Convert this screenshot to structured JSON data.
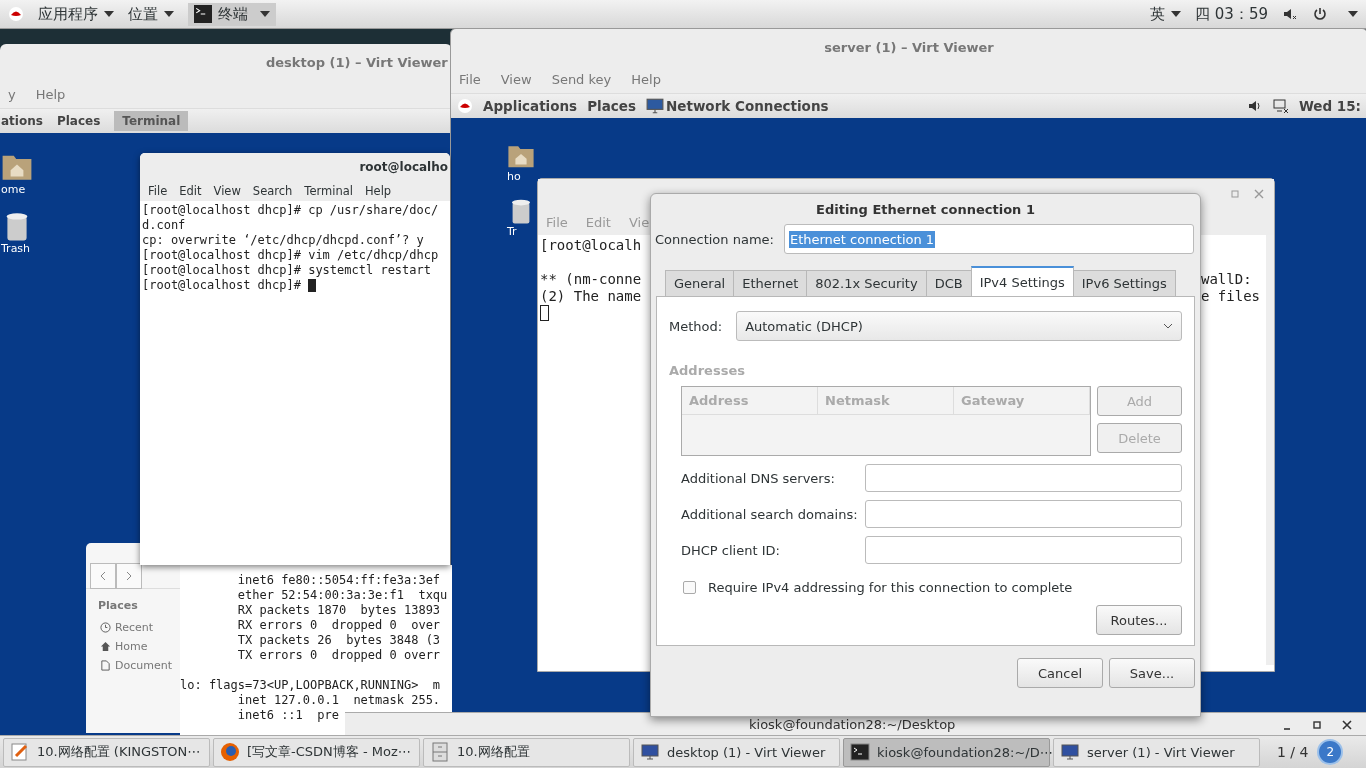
{
  "top_bar": {
    "apps_menu": "应用程序",
    "places_menu": "位置",
    "task": "终端",
    "input_method": "英",
    "clock": "四 03：59"
  },
  "desktop_viewer": {
    "title": "desktop (1) – Virt Viewer",
    "menu": [
      "y",
      "Help"
    ],
    "guest_panel": {
      "menus": [
        "ations",
        "Places"
      ],
      "task": "Terminal"
    },
    "icons": [
      {
        "kind": "folder",
        "label": "ome"
      },
      {
        "kind": "trash",
        "label": "Trash"
      }
    ],
    "terminal": {
      "title": "root@localho",
      "menu": [
        "File",
        "Edit",
        "View",
        "Search",
        "Terminal",
        "Help"
      ],
      "lines": [
        "[root@localhost dhcp]# cp /usr/share/doc/",
        "d.conf",
        "cp: overwrite ‘/etc/dhcp/dhcpd.conf’? y",
        "[root@localhost dhcp]# vim /etc/dhcp/dhcp",
        "[root@localhost dhcp]# systemctl restart"
      ],
      "prompt": "[root@localhost dhcp]#"
    },
    "files": {
      "heading": "Places",
      "items": [
        {
          "kind": "recent",
          "label": "Recent"
        },
        {
          "kind": "home",
          "label": "Home"
        },
        {
          "kind": "document",
          "label": "Document"
        }
      ]
    },
    "output": {
      "blocks": [
        [
          "        inet6 fe80::5054:ff:fe3a:3ef",
          "        ether 52:54:00:3a:3e:f1  txqu",
          "        RX packets 1870  bytes 13893",
          "        RX errors 0  dropped 0  over",
          "        TX packets 26  bytes 3848 (3",
          "        TX errors 0  dropped 0 overr"
        ],
        [
          "lo: flags=73<UP,LOOPBACK,RUNNING>  m",
          "        inet 127.0.0.1  netmask 255.",
          "        inet6 ::1  pre"
        ]
      ]
    }
  },
  "server_viewer": {
    "title": "server (1) – Virt Viewer",
    "menu": [
      "File",
      "View",
      "Send key",
      "Help"
    ],
    "guest_panel": {
      "menus": [
        "Applications",
        "Places"
      ],
      "task": "Network Connections",
      "clock": "Wed 15:"
    },
    "icons": [
      {
        "kind": "folder",
        "label": "ho"
      },
      {
        "kind": "trash",
        "label": "Tr"
      }
    ],
    "terminal": {
      "menu": [
        "File",
        "Edit",
        "Vie"
      ],
      "left_lines": [
        "[root@localh",
        "** (nm-conne",
        "(2) The name"
      ],
      "right_lines": [
        "wallD:",
        "e files"
      ]
    }
  },
  "dialog": {
    "title": "Editing Ethernet connection 1",
    "name_label": "Connection name:",
    "name_value": "Ethernet connection 1",
    "tabs": [
      {
        "label": "General",
        "selected": false
      },
      {
        "label": "Ethernet",
        "selected": false
      },
      {
        "label": "802.1x Security",
        "selected": false
      },
      {
        "label": "DCB",
        "selected": false
      },
      {
        "label": "IPv4 Settings",
        "selected": true
      },
      {
        "label": "IPv6 Settings",
        "selected": false
      }
    ],
    "method_label": "Method:",
    "method_value": "Automatic (DHCP)",
    "addresses_heading": "Addresses",
    "columns": [
      "Address",
      "Netmask",
      "Gateway"
    ],
    "address_buttons": [
      {
        "label": "Add",
        "disabled": true
      },
      {
        "label": "Delete",
        "disabled": true
      }
    ],
    "fields": [
      {
        "label": "Additional DNS servers:"
      },
      {
        "label": "Additional search domains:"
      },
      {
        "label": "DHCP client ID:"
      }
    ],
    "require": {
      "label": "Require IPv4 addressing for this connection to complete",
      "checked": false
    },
    "routes": "Routes...",
    "buttons": [
      "Cancel",
      "Save..."
    ]
  },
  "back_window": {
    "title": "kiosk@foundation28:~/Desktop"
  },
  "taskbar": {
    "items": [
      {
        "kind": "editor",
        "label": "10.网络配置 (KINGSTON⋯",
        "selected": false
      },
      {
        "kind": "browser",
        "label": "[写文章-CSDN博客 - Moz⋯",
        "selected": false
      },
      {
        "kind": "cabinet",
        "label": "10.网络配置",
        "selected": false
      },
      {
        "kind": "monitor",
        "label": "desktop (1) - Virt Viewer",
        "selected": false
      },
      {
        "kind": "terminal",
        "label": "kiosk@foundation28:~/D⋯",
        "selected": true
      },
      {
        "kind": "monitor",
        "label": "server (1) - Virt Viewer",
        "selected": false
      }
    ],
    "pager": "1 / 4",
    "badge": "2"
  }
}
